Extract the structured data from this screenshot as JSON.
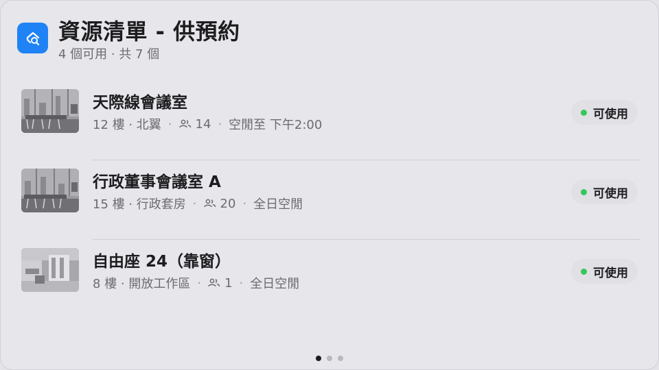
{
  "header": {
    "title": "資源清單 - 供預約",
    "subtitle": "4 個可用 · 共 7 個",
    "icon": "room-search-icon"
  },
  "colors": {
    "accent": "#1f83f5",
    "available": "#34c759"
  },
  "rooms": [
    {
      "name": "天際線會議室",
      "floor": "12 樓 · 北翼",
      "capacity": "14",
      "availability": "空閒至 下午2:00",
      "status": "可使用"
    },
    {
      "name": "行政董事會議室 A",
      "floor": "15 樓 · 行政套房",
      "capacity": "20",
      "availability": "全日空閒",
      "status": "可使用"
    },
    {
      "name": "自由座 24（靠窗）",
      "floor": "8 樓 · 開放工作區",
      "capacity": "1",
      "availability": "全日空閒",
      "status": "可使用"
    }
  ],
  "pager": {
    "pages": 3,
    "current": 1
  }
}
